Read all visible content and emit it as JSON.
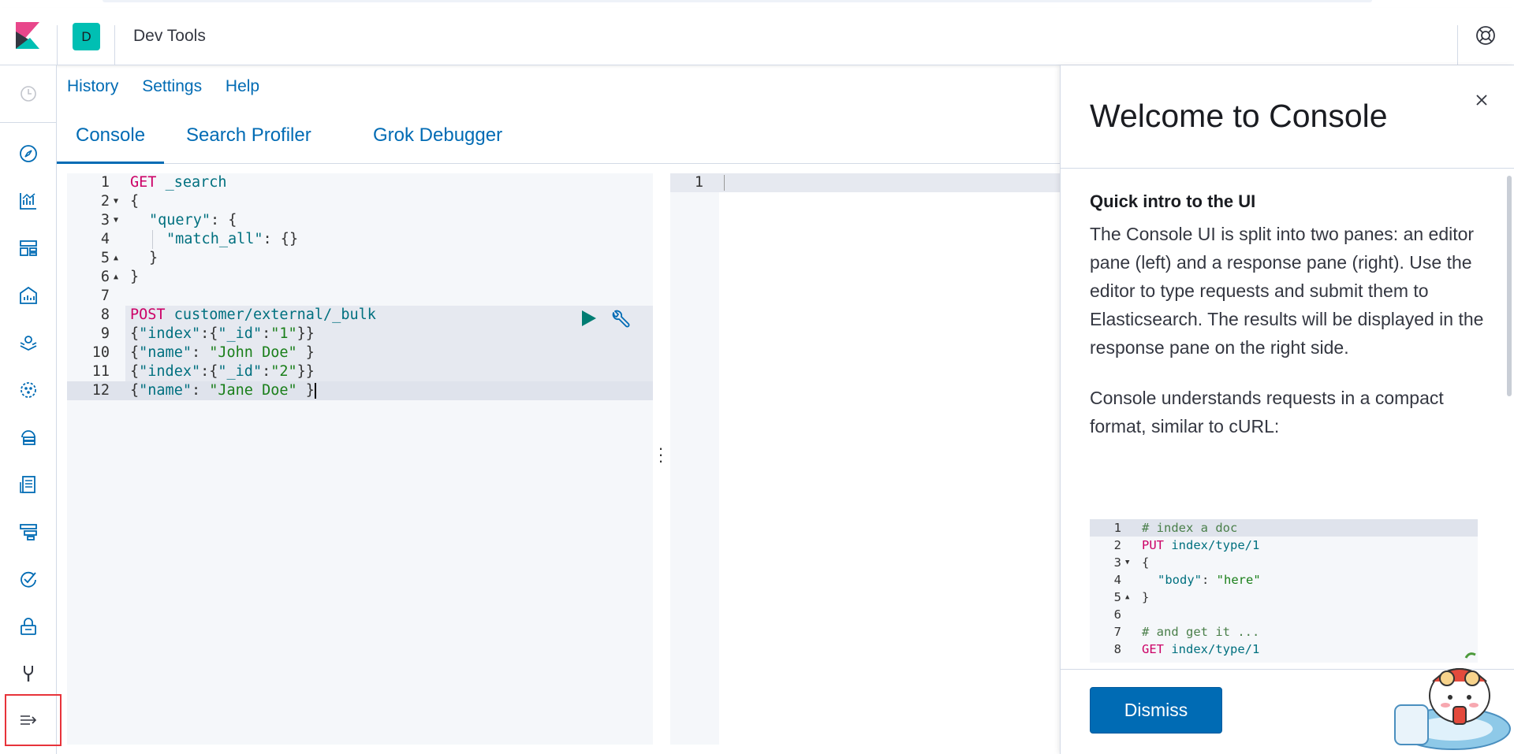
{
  "header": {
    "space_initial": "D",
    "breadcrumb": "Dev Tools"
  },
  "nav": {
    "icons": [
      "recently-viewed-icon",
      "discover-icon",
      "visualize-icon",
      "dashboard-icon",
      "canvas-icon",
      "maps-icon",
      "machine-learning-icon",
      "infrastructure-icon",
      "logs-icon",
      "apm-icon",
      "uptime-icon",
      "siem-icon",
      "dev-tools-icon",
      "management-icon",
      "collapse-menu-icon"
    ]
  },
  "menu": {
    "history": "History",
    "settings": "Settings",
    "help": "Help"
  },
  "tabs": [
    {
      "label": "Console",
      "active": true
    },
    {
      "label": "Search Profiler",
      "active": false
    },
    {
      "label": "Grok Debugger",
      "active": false
    }
  ],
  "editor": {
    "line_numbers": [
      "1",
      "2",
      "3",
      "4",
      "5",
      "6",
      "7",
      "8",
      "9",
      "10",
      "11",
      "12"
    ],
    "lines": [
      {
        "method": "GET",
        "path": "_search"
      },
      {
        "text": "{"
      },
      {
        "key": "\"query\"",
        "rest": ": {"
      },
      {
        "key": "\"match_all\"",
        "rest": ": {}"
      },
      {
        "text": "}"
      },
      {
        "text": "}"
      },
      {
        "text": ""
      },
      {
        "method": "POST",
        "path": "customer/external/_bulk"
      },
      {
        "p1": "{",
        "k1": "\"index\"",
        "p2": ":{",
        "k2": "\"_id\"",
        "p3": ":",
        "s": "\"1\"",
        "p4": "}}"
      },
      {
        "p1": "{",
        "k1": "\"name\"",
        "p2": ": ",
        "s": "\"John Doe\"",
        "p4": " }"
      },
      {
        "p1": "{",
        "k1": "\"index\"",
        "p2": ":{",
        "k2": "\"_id\"",
        "p3": ":",
        "s": "\"2\"",
        "p4": "}}"
      },
      {
        "p1": "{",
        "k1": "\"name\"",
        "p2": ": ",
        "s": "\"Jane Doe\"",
        "p4": " }"
      }
    ]
  },
  "response": {
    "line_numbers": [
      "1"
    ]
  },
  "flyout": {
    "title": "Welcome to Console",
    "section_heading": "Quick intro to the UI",
    "paragraph1": "The Console UI is split into two panes: an editor pane (left) and a response pane (right). Use the editor to type requests and submit them to Elasticsearch. The results will be displayed in the response pane on the right side.",
    "paragraph2": "Console understands requests in a compact format, similar to cURL:",
    "sample": {
      "line_numbers": [
        "1",
        "2",
        "3",
        "4",
        "5",
        "6",
        "7",
        "8"
      ],
      "l1": "# index a doc",
      "l2_method": "PUT",
      "l2_path": "index/type/1",
      "l3": "{",
      "l4_key": "\"body\"",
      "l4_sep": ": ",
      "l4_val": "\"here\"",
      "l5": "}",
      "l7": "# and get it ...",
      "l8_method": "GET",
      "l8_path": "index/type/1"
    },
    "dismiss_label": "Dismiss"
  },
  "colors": {
    "accent": "#006bb4",
    "space_badge": "#00bfb3",
    "keyword": "#cc0066",
    "string": "#1a7f1a",
    "key": "#00707f",
    "highlight_box": "#e7333a"
  }
}
